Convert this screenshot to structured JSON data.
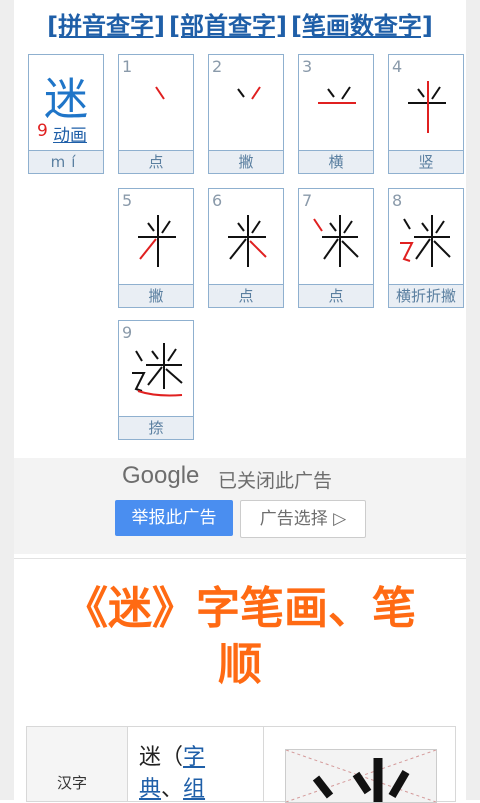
{
  "nav": {
    "pinyin_link": "[拼音查字]",
    "radical_link": "[部首查字]",
    "strokes_link": "[笔画数查字]"
  },
  "character": {
    "char": "迷",
    "stroke_count": "9",
    "animation_link": "动画",
    "pinyin": "mí"
  },
  "strokes": [
    {
      "num": "1",
      "name": "点"
    },
    {
      "num": "2",
      "name": "撇"
    },
    {
      "num": "3",
      "name": "横"
    },
    {
      "num": "4",
      "name": "竖"
    },
    {
      "num": "5",
      "name": "撇"
    },
    {
      "num": "6",
      "name": "点"
    },
    {
      "num": "7",
      "name": "点"
    },
    {
      "num": "8",
      "name": "横折折撇"
    },
    {
      "num": "9",
      "name": "捺"
    }
  ],
  "ad": {
    "brand": "Google",
    "closed_text": "已关闭此广告",
    "report_button": "举报此广告",
    "choice_button": "广告选择 ▷"
  },
  "title": {
    "line1": "《迷》字笔画、笔",
    "line2": "顺"
  },
  "table": {
    "row_label": "汉字",
    "char_line1_prefix": "迷（",
    "dict_link_1": "字",
    "char_line2_link": "典",
    "separator": "、",
    "group_link": "组"
  },
  "colors": {
    "link": "#1f5fa8",
    "stroke_count": "#e02020",
    "title": "#ff6a13",
    "ad_button": "#4a8ef0"
  }
}
